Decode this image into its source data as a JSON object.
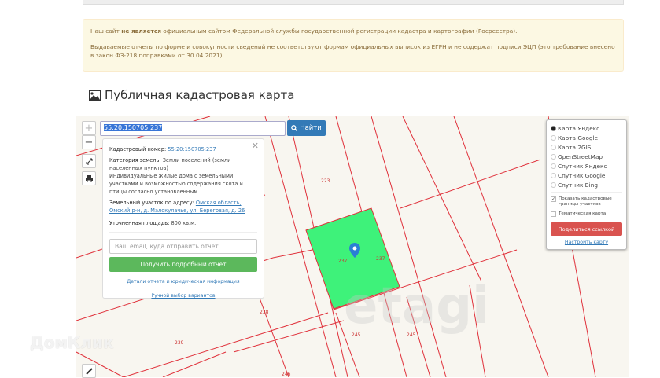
{
  "notice": {
    "line1_pre": "Наш сайт ",
    "line1_bold": "не является",
    "line1_post": " официальным сайтом Федеральной службы государственной регистрации кадастра и картографии (Росреестра).",
    "line2": "Выдаваемые отчеты по форме и совокупности сведений не соответствуют формам официальных выписок из ЕГРН и не содержат подписи ЭЦП (это требование внесено в закон ФЗ-218 поправками от 30.04.2021)."
  },
  "title": "Публичная кадастровая карта",
  "search": {
    "value": "55:20:150705:237",
    "button": "Найти"
  },
  "controls": {
    "zoom_in": "+",
    "zoom_out": "−"
  },
  "popup": {
    "cad_label": "Кадастровый номер:",
    "cad_value": "55:20:150705:237",
    "cat_label": "Категория земель:",
    "cat_value": "Земли поселений (земли населенных пунктов)",
    "use": "Индивидуальные жилые дома с земельными участками и возможностью содержания скота и птицы согласно установленным...",
    "addr_label": "Земельный участок по адресу:",
    "addr_value": "Омская область, Омский р-н, д. Малокулачье, ул. Береговая, д. 26",
    "area_label": "Уточненная площадь:",
    "area_value": "800 кв.м.",
    "email_placeholder": "Ваш email, куда отправить отчет",
    "get_button": "Получить подробный отчет",
    "details_link": "Детали отчета и юридическая информация",
    "manual_link": "Ручной выбор вариантов"
  },
  "layers": {
    "options": [
      "Карта Яндекс",
      "Карта Google",
      "Карта 2GIS",
      "OpenStreetMap",
      "Спутник Яндекс",
      "Спутник Google",
      "Спутник Bing"
    ],
    "selected": 0,
    "show_borders": "Показать кадастровые границы участков",
    "show_borders_checked": true,
    "thematic": "Тематическая карта",
    "thematic_checked": false,
    "share": "Поделиться ссылкой",
    "configure": "Настроить карту"
  },
  "parcels": {
    "p223": "223",
    "p237a": "237",
    "p237b": "237",
    "p238": "238",
    "p239": "239",
    "p245a": "245",
    "p245b": "245",
    "p246": "246"
  },
  "watermarks": {
    "etagi": "etagi",
    "domclick": "ДомКлик"
  },
  "colors": {
    "parcel_line": "#e0303a",
    "selected_parcel": "#3ef27a",
    "pin": "#2a7fd4"
  }
}
